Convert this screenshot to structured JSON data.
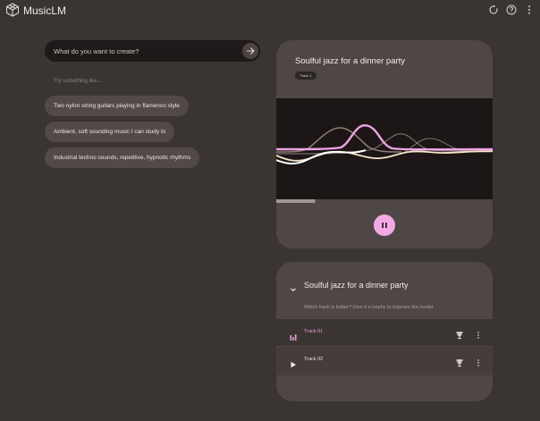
{
  "app": {
    "title": "MusicLM"
  },
  "topbar": {
    "icons": [
      "logo-icon",
      "history-icon",
      "help-icon",
      "more-vert-icon"
    ]
  },
  "prompt": {
    "placeholder": "What do you want to create?",
    "value": "",
    "submit_icon": "arrow-right-icon"
  },
  "suggestions": {
    "label": "Try something like...",
    "items": [
      "Two nylon string guitars playing in flamenco style",
      "Ambient, soft sounding music I can study to",
      "Industrial techno sounds, repetitive, hypnotic rhythms"
    ]
  },
  "player": {
    "title": "Soulful jazz for a dinner party",
    "badge": "Track 1",
    "state_icon": "pause-icon",
    "progress": 0.18,
    "colors": {
      "accent": "#f3a9e5",
      "wave_pink": "#f0a2e6",
      "wave_cream": "#f5e6c8"
    }
  },
  "comparison": {
    "title": "Soulful jazz for a dinner party",
    "hint": "Which track is better? Give it a trophy to improve the model.",
    "tracks": [
      {
        "label": "Track 01",
        "icon": "equalizer-icon",
        "active": true
      },
      {
        "label": "Track 02",
        "icon": "play-icon",
        "active": false
      }
    ]
  }
}
